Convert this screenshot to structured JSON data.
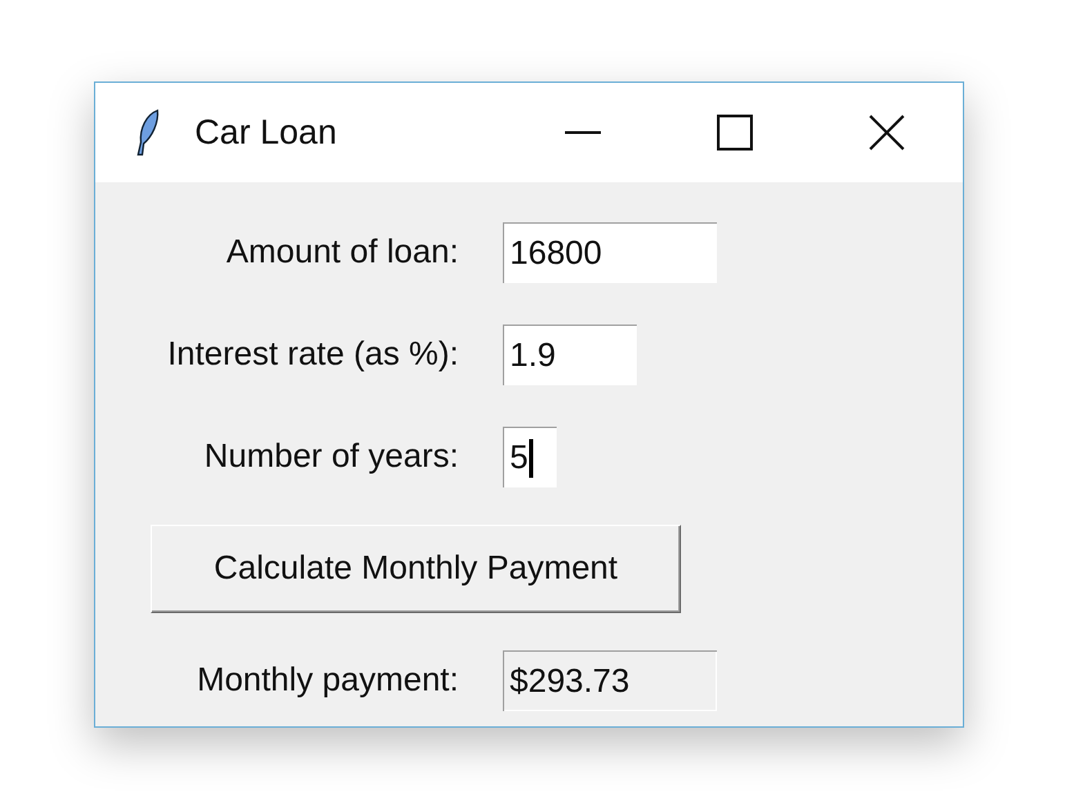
{
  "window": {
    "title": "Car Loan",
    "controls": [
      {
        "kind": "minimize"
      },
      {
        "kind": "maximize"
      },
      {
        "kind": "close"
      }
    ]
  },
  "fields": [
    {
      "label": "Amount of loan:",
      "value": "16800",
      "readonly": false,
      "focused": false
    },
    {
      "label": "Interest rate (as %):",
      "value": "1.9",
      "readonly": false,
      "focused": false
    },
    {
      "label": "Number of years:",
      "value": "5",
      "readonly": false,
      "focused": true
    }
  ],
  "button": {
    "label": "Calculate Monthly Payment"
  },
  "result": {
    "label": "Monthly payment:",
    "value": "$293.73",
    "readonly": true,
    "focused": false
  }
}
